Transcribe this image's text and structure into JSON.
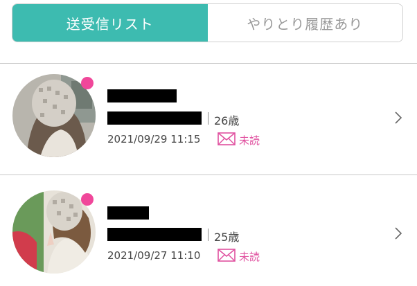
{
  "tabs": {
    "active_label": "送受信リスト",
    "inactive_label": "やりとり履歴あり"
  },
  "colors": {
    "accent": "#3dbbb0",
    "online_dot": "#f0479a",
    "unread": "#e0509f"
  },
  "messages": [
    {
      "age": "26歳",
      "date": "2021/09/29 11:15",
      "status": "未読",
      "status_icon": "envelope-icon"
    },
    {
      "age": "25歳",
      "date": "2021/09/27 11:10",
      "status": "未読",
      "status_icon": "envelope-icon"
    }
  ]
}
